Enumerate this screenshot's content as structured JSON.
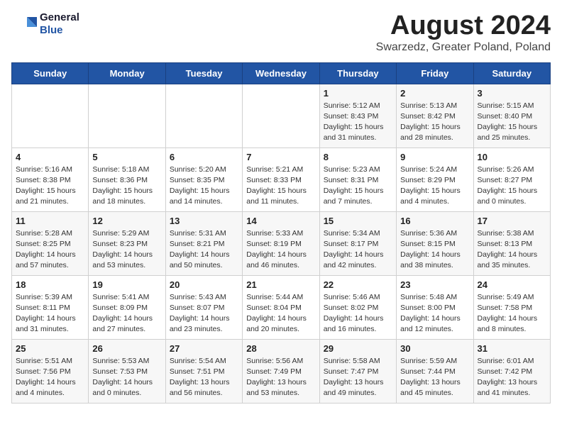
{
  "header": {
    "logo_line1": "General",
    "logo_line2": "Blue",
    "title": "August 2024",
    "subtitle": "Swarzedz, Greater Poland, Poland"
  },
  "weekdays": [
    "Sunday",
    "Monday",
    "Tuesday",
    "Wednesday",
    "Thursday",
    "Friday",
    "Saturday"
  ],
  "weeks": [
    [
      {
        "day": "",
        "info": ""
      },
      {
        "day": "",
        "info": ""
      },
      {
        "day": "",
        "info": ""
      },
      {
        "day": "",
        "info": ""
      },
      {
        "day": "1",
        "info": "Sunrise: 5:12 AM\nSunset: 8:43 PM\nDaylight: 15 hours\nand 31 minutes."
      },
      {
        "day": "2",
        "info": "Sunrise: 5:13 AM\nSunset: 8:42 PM\nDaylight: 15 hours\nand 28 minutes."
      },
      {
        "day": "3",
        "info": "Sunrise: 5:15 AM\nSunset: 8:40 PM\nDaylight: 15 hours\nand 25 minutes."
      }
    ],
    [
      {
        "day": "4",
        "info": "Sunrise: 5:16 AM\nSunset: 8:38 PM\nDaylight: 15 hours\nand 21 minutes."
      },
      {
        "day": "5",
        "info": "Sunrise: 5:18 AM\nSunset: 8:36 PM\nDaylight: 15 hours\nand 18 minutes."
      },
      {
        "day": "6",
        "info": "Sunrise: 5:20 AM\nSunset: 8:35 PM\nDaylight: 15 hours\nand 14 minutes."
      },
      {
        "day": "7",
        "info": "Sunrise: 5:21 AM\nSunset: 8:33 PM\nDaylight: 15 hours\nand 11 minutes."
      },
      {
        "day": "8",
        "info": "Sunrise: 5:23 AM\nSunset: 8:31 PM\nDaylight: 15 hours\nand 7 minutes."
      },
      {
        "day": "9",
        "info": "Sunrise: 5:24 AM\nSunset: 8:29 PM\nDaylight: 15 hours\nand 4 minutes."
      },
      {
        "day": "10",
        "info": "Sunrise: 5:26 AM\nSunset: 8:27 PM\nDaylight: 15 hours\nand 0 minutes."
      }
    ],
    [
      {
        "day": "11",
        "info": "Sunrise: 5:28 AM\nSunset: 8:25 PM\nDaylight: 14 hours\nand 57 minutes."
      },
      {
        "day": "12",
        "info": "Sunrise: 5:29 AM\nSunset: 8:23 PM\nDaylight: 14 hours\nand 53 minutes."
      },
      {
        "day": "13",
        "info": "Sunrise: 5:31 AM\nSunset: 8:21 PM\nDaylight: 14 hours\nand 50 minutes."
      },
      {
        "day": "14",
        "info": "Sunrise: 5:33 AM\nSunset: 8:19 PM\nDaylight: 14 hours\nand 46 minutes."
      },
      {
        "day": "15",
        "info": "Sunrise: 5:34 AM\nSunset: 8:17 PM\nDaylight: 14 hours\nand 42 minutes."
      },
      {
        "day": "16",
        "info": "Sunrise: 5:36 AM\nSunset: 8:15 PM\nDaylight: 14 hours\nand 38 minutes."
      },
      {
        "day": "17",
        "info": "Sunrise: 5:38 AM\nSunset: 8:13 PM\nDaylight: 14 hours\nand 35 minutes."
      }
    ],
    [
      {
        "day": "18",
        "info": "Sunrise: 5:39 AM\nSunset: 8:11 PM\nDaylight: 14 hours\nand 31 minutes."
      },
      {
        "day": "19",
        "info": "Sunrise: 5:41 AM\nSunset: 8:09 PM\nDaylight: 14 hours\nand 27 minutes."
      },
      {
        "day": "20",
        "info": "Sunrise: 5:43 AM\nSunset: 8:07 PM\nDaylight: 14 hours\nand 23 minutes."
      },
      {
        "day": "21",
        "info": "Sunrise: 5:44 AM\nSunset: 8:04 PM\nDaylight: 14 hours\nand 20 minutes."
      },
      {
        "day": "22",
        "info": "Sunrise: 5:46 AM\nSunset: 8:02 PM\nDaylight: 14 hours\nand 16 minutes."
      },
      {
        "day": "23",
        "info": "Sunrise: 5:48 AM\nSunset: 8:00 PM\nDaylight: 14 hours\nand 12 minutes."
      },
      {
        "day": "24",
        "info": "Sunrise: 5:49 AM\nSunset: 7:58 PM\nDaylight: 14 hours\nand 8 minutes."
      }
    ],
    [
      {
        "day": "25",
        "info": "Sunrise: 5:51 AM\nSunset: 7:56 PM\nDaylight: 14 hours\nand 4 minutes."
      },
      {
        "day": "26",
        "info": "Sunrise: 5:53 AM\nSunset: 7:53 PM\nDaylight: 14 hours\nand 0 minutes."
      },
      {
        "day": "27",
        "info": "Sunrise: 5:54 AM\nSunset: 7:51 PM\nDaylight: 13 hours\nand 56 minutes."
      },
      {
        "day": "28",
        "info": "Sunrise: 5:56 AM\nSunset: 7:49 PM\nDaylight: 13 hours\nand 53 minutes."
      },
      {
        "day": "29",
        "info": "Sunrise: 5:58 AM\nSunset: 7:47 PM\nDaylight: 13 hours\nand 49 minutes."
      },
      {
        "day": "30",
        "info": "Sunrise: 5:59 AM\nSunset: 7:44 PM\nDaylight: 13 hours\nand 45 minutes."
      },
      {
        "day": "31",
        "info": "Sunrise: 6:01 AM\nSunset: 7:42 PM\nDaylight: 13 hours\nand 41 minutes."
      }
    ]
  ]
}
